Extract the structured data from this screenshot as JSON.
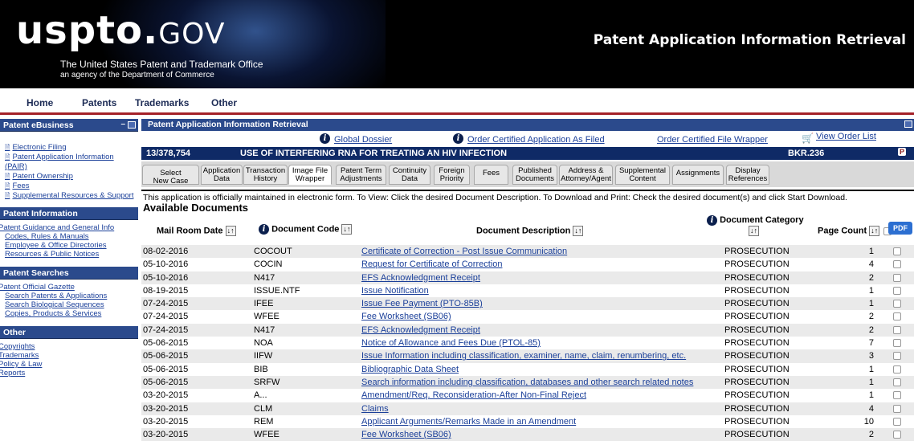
{
  "header": {
    "logo_main": "uspto.",
    "logo_suffix": "GOV",
    "subtitle1": "The United States Patent and Trademark Office",
    "subtitle2": "an agency of the Department of Commerce",
    "app_title": "Patent Application Information Retrieval"
  },
  "topnav": [
    "Home",
    "Patents",
    "Trademarks",
    "Other"
  ],
  "sidebar": {
    "ebusiness": {
      "title": "Patent eBusiness",
      "links": [
        "Electronic Filing",
        "Patent Application Information (PAIR)",
        "Patent Ownership",
        "Fees",
        "Supplemental Resources & Support"
      ]
    },
    "information": {
      "title": "Patent Information",
      "links": [
        "Patent Guidance and General Info",
        "Codes, Rules & Manuals",
        "Employee & Office Directories",
        "Resources & Public Notices"
      ]
    },
    "searches": {
      "title": "Patent Searches",
      "links": [
        "Patent Official Gazette",
        "Search Patents & Applications",
        "Search Biological Sequences",
        "Copies, Products & Services"
      ]
    },
    "other": {
      "title": "Other",
      "links": [
        "Copyrights",
        "Trademarks",
        "Policy & Law",
        "Reports"
      ]
    }
  },
  "panel": {
    "title": "Patent Application Information Retrieval",
    "links": {
      "global_dossier": "Global Dossier",
      "order_certified_app": "Order Certified Application As Filed",
      "order_certified_wrapper": "Order Certified File Wrapper",
      "view_order_list": "View Order List"
    },
    "app_number": "13/378,754",
    "app_title": "USE OF INTERFERING RNA FOR TREATING AN HIV INFECTION",
    "docket": "BKR.236",
    "tabs": [
      {
        "l1": "Select",
        "l2": "New Case"
      },
      {
        "l1": "Application",
        "l2": "Data"
      },
      {
        "l1": "Transaction",
        "l2": "History"
      },
      {
        "l1": "Image File",
        "l2": "Wrapper"
      },
      {
        "l1": "Patent Term",
        "l2": "Adjustments"
      },
      {
        "l1": "Continuity",
        "l2": "Data"
      },
      {
        "l1": "Foreign",
        "l2": "Priority"
      },
      {
        "l1": "Fees",
        "l2": ""
      },
      {
        "l1": "Published",
        "l2": "Documents"
      },
      {
        "l1": "Address &",
        "l2": "Attorney/Agent"
      },
      {
        "l1": "Supplemental",
        "l2": "Content"
      },
      {
        "l1": "Assignments",
        "l2": ""
      },
      {
        "l1": "Display",
        "l2": "References"
      }
    ],
    "notice": "This application is officially maintained in electronic form. To View: Click the desired Document Description. To Download and Print: Check the desired document(s) and click Start Download.",
    "available_heading": "Available Documents",
    "columns": {
      "mail_date": "Mail Room Date",
      "doc_code": "Document Code",
      "doc_desc": "Document Description",
      "doc_cat": "Document Category",
      "page_count": "Page Count",
      "pdf": "PDF"
    },
    "rows": [
      {
        "date": "08-02-2016",
        "code": "COCOUT",
        "desc": "Certificate of Correction - Post Issue Communication",
        "cat": "PROSECUTION",
        "pages": "1"
      },
      {
        "date": "05-10-2016",
        "code": "COCIN",
        "desc": "Request for Certificate of Correction",
        "cat": "PROSECUTION",
        "pages": "4"
      },
      {
        "date": "05-10-2016",
        "code": "N417",
        "desc": "EFS Acknowledgment Receipt",
        "cat": "PROSECUTION",
        "pages": "2"
      },
      {
        "date": "08-19-2015",
        "code": "ISSUE.NTF",
        "desc": "Issue Notification",
        "cat": "PROSECUTION",
        "pages": "1"
      },
      {
        "date": "07-24-2015",
        "code": "IFEE",
        "desc": "Issue Fee Payment (PTO-85B)",
        "cat": "PROSECUTION",
        "pages": "1"
      },
      {
        "date": "07-24-2015",
        "code": "WFEE",
        "desc": "Fee Worksheet (SB06)",
        "cat": "PROSECUTION",
        "pages": "2"
      },
      {
        "date": "07-24-2015",
        "code": "N417",
        "desc": "EFS Acknowledgment Receipt",
        "cat": "PROSECUTION",
        "pages": "2"
      },
      {
        "date": "05-06-2015",
        "code": "NOA",
        "desc": "Notice of Allowance and Fees Due (PTOL-85)",
        "cat": "PROSECUTION",
        "pages": "7"
      },
      {
        "date": "05-06-2015",
        "code": "IIFW",
        "desc": "Issue Information including classification, examiner, name, claim, renumbering, etc.",
        "cat": "PROSECUTION",
        "pages": "3"
      },
      {
        "date": "05-06-2015",
        "code": "BIB",
        "desc": "Bibliographic Data Sheet",
        "cat": "PROSECUTION",
        "pages": "1"
      },
      {
        "date": "05-06-2015",
        "code": "SRFW",
        "desc": "Search information including classification, databases and other search related notes",
        "cat": "PROSECUTION",
        "pages": "1"
      },
      {
        "date": "03-20-2015",
        "code": "A...",
        "desc": "Amendment/Req. Reconsideration-After Non-Final Reject",
        "cat": "PROSECUTION",
        "pages": "1"
      },
      {
        "date": "03-20-2015",
        "code": "CLM",
        "desc": "Claims",
        "cat": "PROSECUTION",
        "pages": "4"
      },
      {
        "date": "03-20-2015",
        "code": "REM",
        "desc": "Applicant Arguments/Remarks Made in an Amendment",
        "cat": "PROSECUTION",
        "pages": "10"
      },
      {
        "date": "03-20-2015",
        "code": "WFEE",
        "desc": "Fee Worksheet (SB06)",
        "cat": "PROSECUTION",
        "pages": "2"
      }
    ]
  },
  "colors": {
    "banner": "#000000",
    "nav_rule": "#a42128",
    "panel_header": "#2b4a8c",
    "app_bar": "#0f2a66",
    "link": "#1a3f99"
  }
}
